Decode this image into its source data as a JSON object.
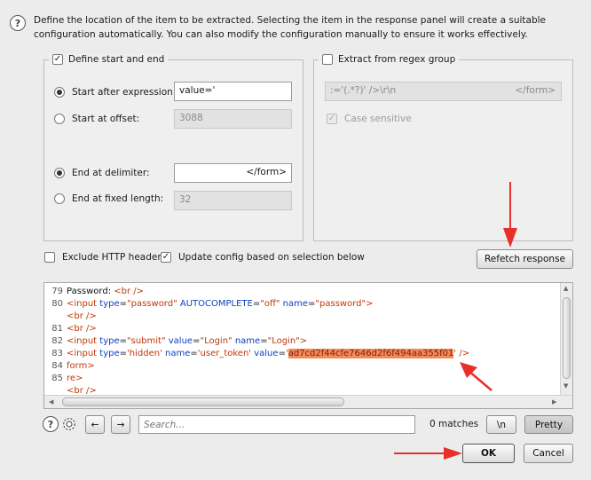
{
  "description": {
    "text": "Define the location of the item to be extracted. Selecting the item in the response panel will create a suitable configuration automatically. You can also modify the configuration manually to ensure it works effectively."
  },
  "start_end": {
    "legend": "Define start and end",
    "checked": true,
    "start_after_label": "Start after expression:",
    "start_after_value": "value='",
    "start_offset_label": "Start at offset:",
    "start_offset_value": "3088",
    "end_delimiter_label": "End at delimiter:",
    "end_delimiter_value": "</form>",
    "end_fixed_label": "End at fixed length:",
    "end_fixed_value": "32"
  },
  "regex": {
    "legend": "Extract from regex group",
    "checked": false,
    "field_left": ":='(.*?)' />\\r\\n",
    "field_right": "</form>",
    "case_label": "Case sensitive",
    "case_checked": true
  },
  "options": {
    "exclude_label": "Exclude HTTP headers",
    "exclude_checked": false,
    "update_label": "Update config based on selection below",
    "update_checked": true,
    "refetch_label": "Refetch response"
  },
  "editor": {
    "lines": [
      {
        "num": "79",
        "parts": [
          [
            "txt",
            "Password: "
          ],
          [
            "tag",
            "<br />"
          ]
        ]
      },
      {
        "num": "80",
        "parts": [
          [
            "tag",
            "<input "
          ],
          [
            "attr",
            "type"
          ],
          [
            "txt",
            "="
          ],
          [
            "str",
            "\"password\""
          ],
          [
            "txt",
            " "
          ],
          [
            "attr",
            "AUTOCOMPLETE"
          ],
          [
            "txt",
            "="
          ],
          [
            "str",
            "\"off\""
          ],
          [
            "txt",
            " "
          ],
          [
            "attr",
            "name"
          ],
          [
            "txt",
            "="
          ],
          [
            "str",
            "\"password\""
          ],
          [
            "tag",
            ">"
          ]
        ]
      },
      {
        "num": "",
        "parts": [
          [
            "tag",
            "<br />"
          ]
        ]
      },
      {
        "num": "81",
        "parts": [
          [
            "tag",
            "<br />"
          ]
        ]
      },
      {
        "num": "82",
        "parts": [
          [
            "tag",
            "<input "
          ],
          [
            "attr",
            "type"
          ],
          [
            "txt",
            "="
          ],
          [
            "str",
            "\"submit\""
          ],
          [
            "txt",
            " "
          ],
          [
            "attr",
            "value"
          ],
          [
            "txt",
            "="
          ],
          [
            "str",
            "\"Login\""
          ],
          [
            "txt",
            " "
          ],
          [
            "attr",
            "name"
          ],
          [
            "txt",
            "="
          ],
          [
            "str",
            "\"Login\""
          ],
          [
            "tag",
            ">"
          ]
        ]
      },
      {
        "num": "83",
        "parts": [
          [
            "tag",
            "<input "
          ],
          [
            "attr",
            "type"
          ],
          [
            "txt",
            "="
          ],
          [
            "str",
            "'hidden'"
          ],
          [
            "txt",
            " "
          ],
          [
            "attr",
            "name"
          ],
          [
            "txt",
            "="
          ],
          [
            "str",
            "'user_token'"
          ],
          [
            "txt",
            " "
          ],
          [
            "attr",
            "value"
          ],
          [
            "txt",
            "="
          ],
          [
            "str",
            "'"
          ],
          [
            "hl",
            "ad7cd2f44cfe7646d2f6f494aa355f01"
          ],
          [
            "str",
            "'"
          ],
          [
            "tag",
            " />"
          ]
        ]
      },
      {
        "num": "84",
        "parts": [
          [
            "tag",
            "form>"
          ]
        ]
      },
      {
        "num": "85",
        "parts": [
          [
            "tag",
            "re>"
          ]
        ]
      },
      {
        "num": "",
        "parts": [
          [
            "tag",
            "<br />"
          ]
        ]
      }
    ]
  },
  "search": {
    "placeholder": "Search...",
    "matches": "0 matches",
    "newline_label": "\\n",
    "pretty_label": "Pretty"
  },
  "footer": {
    "ok_label": "OK",
    "cancel_label": "Cancel"
  },
  "icons": {
    "help": "?",
    "prev": "←",
    "next": "→"
  },
  "colors": {
    "highlight": "#f48a5a",
    "annotation_arrow": "#e8302a"
  }
}
